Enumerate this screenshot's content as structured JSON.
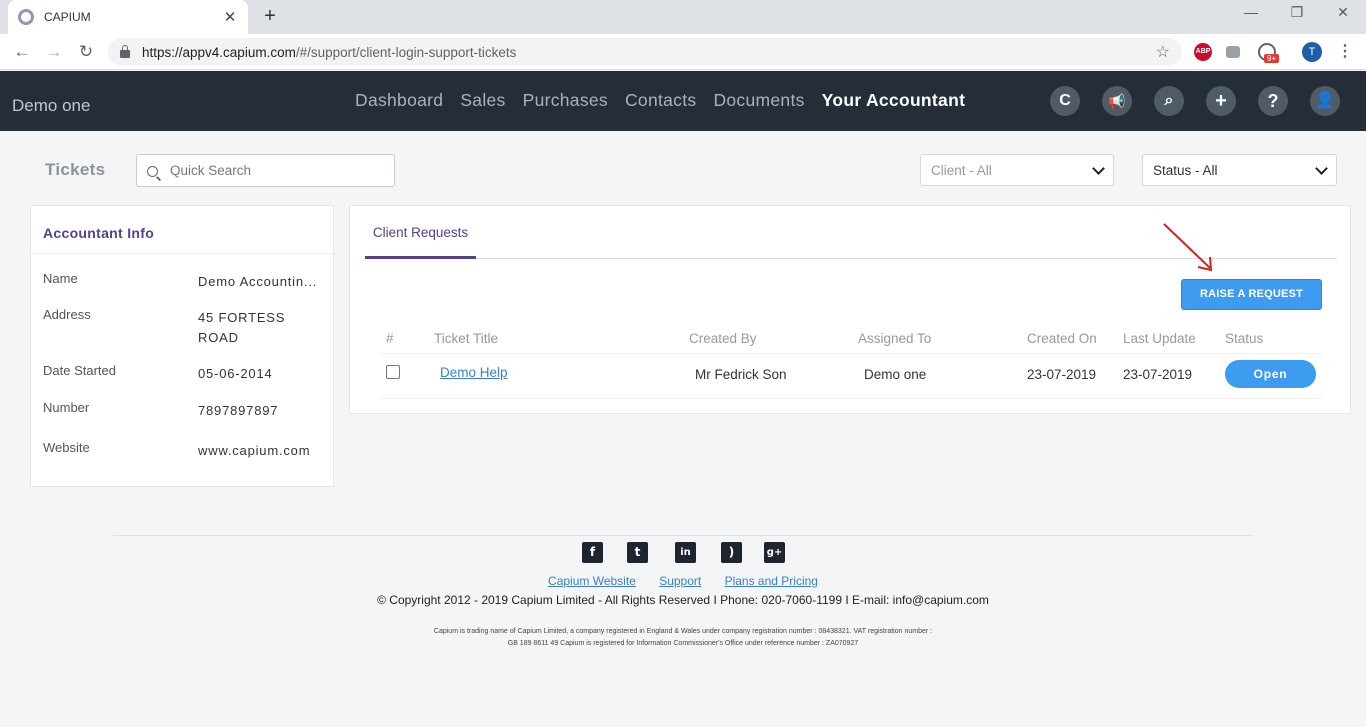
{
  "browser": {
    "tab_title": "CAPIUM",
    "url_host": "https://appv4.capium.com",
    "url_path": "/#/support/client-login-support-tickets",
    "profile_initial": "T",
    "abp_label": "ABP",
    "badge_count": "9+"
  },
  "header": {
    "org_name": "Demo one",
    "nav": [
      "Dashboard",
      "Sales",
      "Purchases",
      "Contacts",
      "Documents",
      "Your Accountant"
    ],
    "active_nav": "Your Accountant"
  },
  "filters": {
    "page_title": "Tickets",
    "search_placeholder": "Quick Search",
    "client_select": "Client - All",
    "status_select": "Status - All"
  },
  "accountant_info": {
    "heading": "Accountant Info",
    "rows": [
      {
        "label": "Name",
        "value": "Demo Accountin..."
      },
      {
        "label": "Address",
        "value": "45 FORTESS ROAD"
      },
      {
        "label": "Date Started",
        "value": "05-06-2014"
      },
      {
        "label": "Number",
        "value": "7897897897"
      },
      {
        "label": "Website",
        "value": "www.capium.com"
      }
    ]
  },
  "tickets": {
    "tab_label": "Client Requests",
    "raise_button": "RAISE A REQUEST",
    "columns": [
      "#",
      "Ticket Title",
      "Created By",
      "Assigned To",
      "Created On",
      "Last Update",
      "Status"
    ],
    "rows": [
      {
        "title": "Demo Help",
        "created_by": "Mr Fedrick Son",
        "assigned_to": "Demo one",
        "created_on": "23-07-2019",
        "last_update": "23-07-2019",
        "status": "Open"
      }
    ]
  },
  "annotation": {
    "arrow_color": "#d32020"
  },
  "footer": {
    "social": [
      "facebook-icon",
      "twitter-icon",
      "linkedin-icon",
      "rss-icon",
      "google-plus-icon"
    ],
    "links": [
      "Capium Website",
      "Support",
      "Plans and Pricing"
    ],
    "copyright": "© Copyright 2012 - 2019 Capium Limited - All Rights Reserved I Phone: 020-7060-1199 I E-mail: info@capium.com",
    "legal_line1": "Capium is trading name of Capium Limited, a company registered in England & Wales under company registration number : 08438321. VAT registration number :",
    "legal_line2": "GB 189 8611 49 Capium is registered for Information Commissioner's Office under reference number : ZA070927"
  }
}
